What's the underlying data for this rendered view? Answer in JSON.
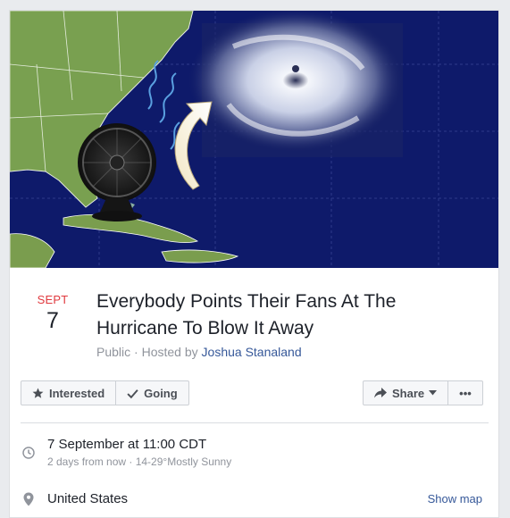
{
  "event": {
    "cover_image_label": "hurricane-and-fan-cover",
    "date_month": "SEPT",
    "date_day": "7",
    "title": "Everybody Points Their Fans At The Hurricane To Blow It Away",
    "visibility": "Public",
    "hosted_by_prefix": "Hosted by",
    "host_name": "Joshua Stanaland"
  },
  "actions": {
    "interested_label": "Interested",
    "going_label": "Going",
    "share_label": "Share",
    "more_label": "•••"
  },
  "details": {
    "when_main": "7 September at 11:00 CDT",
    "when_sub": "2 days from now · 14-29°Mostly Sunny",
    "location": "United States",
    "show_map_label": "Show map"
  },
  "colors": {
    "accent_month": "#e0393e",
    "link": "#365899",
    "ocean": "#0e1a6a"
  }
}
